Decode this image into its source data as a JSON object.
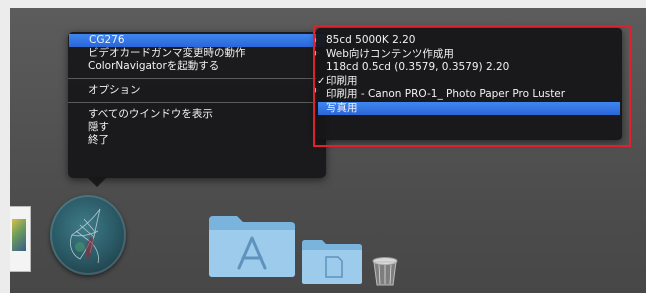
{
  "main_menu": {
    "items": [
      {
        "label": "CG276",
        "submenu": true,
        "selected": true
      },
      {
        "label": "ビデオカードガンマ変更時の動作",
        "submenu": true
      },
      {
        "label": "ColorNavigatorを起動する",
        "submenu": false
      },
      {
        "label": "オプション",
        "submenu": true
      },
      {
        "label": "すべてのウインドウを表示",
        "submenu": false
      },
      {
        "label": "隠す",
        "submenu": false
      },
      {
        "label": "終了",
        "submenu": false
      }
    ]
  },
  "submenu": {
    "items": [
      {
        "label": "85cd 5000K 2.20",
        "checked": false,
        "selected": false
      },
      {
        "label": "Web向けコンテンツ作成用",
        "checked": false,
        "selected": false
      },
      {
        "label": "118cd 0.5cd  (0.3579, 0.3579) 2.20",
        "checked": false,
        "selected": false
      },
      {
        "label": "印刷用",
        "checked": true,
        "selected": false
      },
      {
        "label": "印刷用 - Canon PRO-1_ Photo Paper Pro Luster",
        "checked": false,
        "selected": false
      },
      {
        "label": "写真用",
        "checked": false,
        "selected": true
      }
    ]
  },
  "icons": {
    "submenu_arrow": "▶",
    "checkmark": "✓"
  },
  "colors": {
    "highlight": "#2f6fe0",
    "annotation_box": "#e0202a",
    "menu_bg": "#161618"
  }
}
